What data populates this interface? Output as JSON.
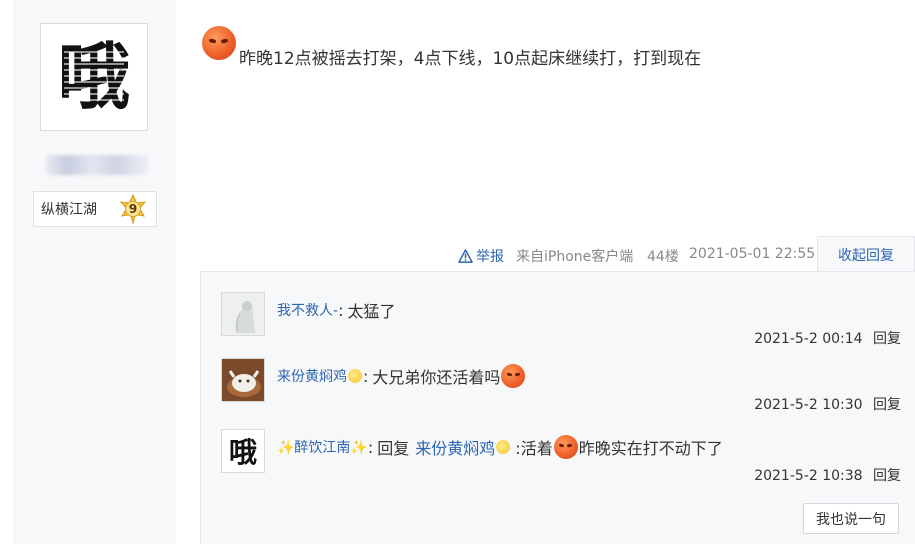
{
  "user": {
    "avatar_char": "哦",
    "rank": {
      "title": "纵横江湖",
      "level": "9"
    }
  },
  "post": {
    "text": "昨晚12点被摇去打架，4点下线，10点起床继续打，打到现在",
    "emoji": "angry-face-emoji"
  },
  "meta": {
    "report_label": "举报",
    "source": "来自iPhone客户端",
    "floor": "44楼",
    "timestamp": "2021-05-01 22:55",
    "collapse_label": "收起回复"
  },
  "replies": [
    {
      "user": "我不救人-",
      "separator": ":",
      "content": "太猛了",
      "time": "2021-5-2 00:14",
      "reply_label": "回复"
    },
    {
      "user": "来份黄焖鸡",
      "separator": ":",
      "content": "大兄弟你还活着吗",
      "time": "2021-5-2 10:30",
      "reply_label": "回复"
    },
    {
      "user": "✨醉饮江南✨",
      "separator": ":",
      "reply_prefix": "回复",
      "mention": "来份黄焖鸡",
      "content_a": ":活着",
      "content_b": "昨晚实在打不动下了",
      "avatar_char": "哦",
      "time": "2021-5-2 10:38",
      "reply_label": "回复"
    }
  ],
  "say_button": "我也说一句",
  "colors": {
    "link": "#2d64b3",
    "panel_bg": "#f7f8fa",
    "meta_gray": "#888888"
  }
}
